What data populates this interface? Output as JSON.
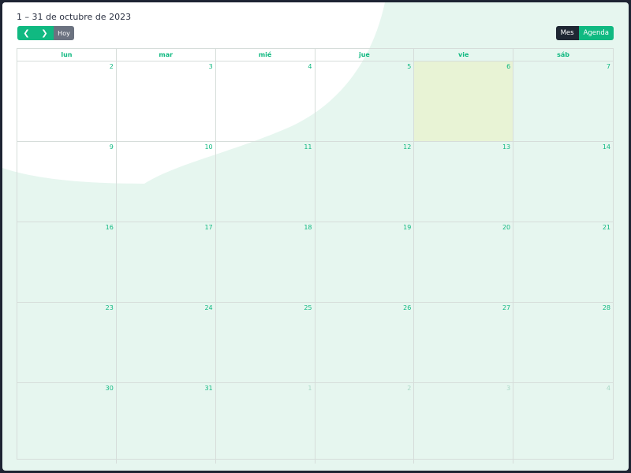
{
  "header": {
    "title": "1 – 31 de octubre de 2023"
  },
  "nav": {
    "prev_icon": "chevron-left-icon",
    "next_icon": "chevron-right-icon",
    "today_label": "Hoy"
  },
  "view_switch": {
    "items": [
      {
        "label": "Mes",
        "active": true
      },
      {
        "label": "Agenda",
        "active": false
      }
    ]
  },
  "calendar": {
    "weekdays": [
      "lun",
      "mar",
      "mié",
      "jue",
      "vie",
      "sáb"
    ],
    "weeks": [
      [
        {
          "d": "2"
        },
        {
          "d": "3"
        },
        {
          "d": "4"
        },
        {
          "d": "5"
        },
        {
          "d": "6",
          "today": true
        },
        {
          "d": "7"
        }
      ],
      [
        {
          "d": "9"
        },
        {
          "d": "10"
        },
        {
          "d": "11"
        },
        {
          "d": "12"
        },
        {
          "d": "13"
        },
        {
          "d": "14"
        }
      ],
      [
        {
          "d": "16"
        },
        {
          "d": "17"
        },
        {
          "d": "18"
        },
        {
          "d": "19"
        },
        {
          "d": "20"
        },
        {
          "d": "21"
        }
      ],
      [
        {
          "d": "23"
        },
        {
          "d": "24"
        },
        {
          "d": "25"
        },
        {
          "d": "26"
        },
        {
          "d": "27"
        },
        {
          "d": "28"
        }
      ],
      [
        {
          "d": "30"
        },
        {
          "d": "31"
        },
        {
          "d": "1",
          "muted": true
        },
        {
          "d": "2",
          "muted": true
        },
        {
          "d": "3",
          "muted": true
        },
        {
          "d": "4",
          "muted": true
        }
      ]
    ]
  },
  "colors": {
    "accent": "#10b981",
    "today_fill": "#e8f3d5",
    "frame_bg": "#e6f6ef",
    "page_bg": "#1e2433"
  }
}
